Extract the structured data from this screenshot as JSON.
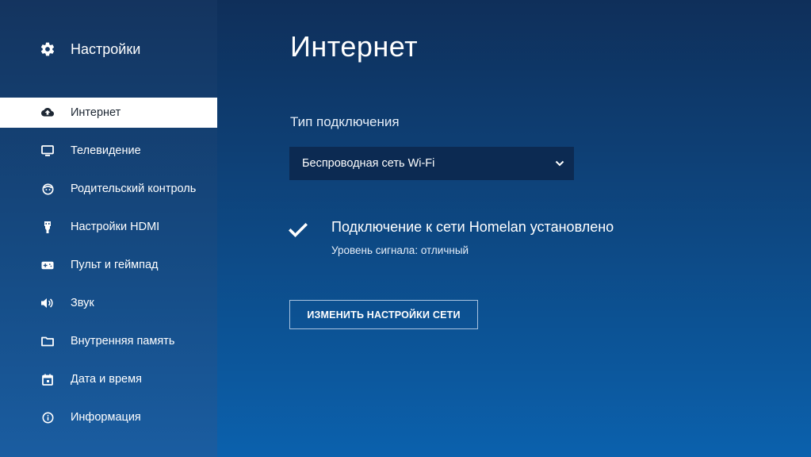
{
  "sidebar": {
    "header": {
      "title": "Настройки",
      "icon": "gear-icon"
    },
    "items": [
      {
        "label": "Интернет",
        "icon": "cloud-upload-icon",
        "active": true
      },
      {
        "label": "Телевидение",
        "icon": "tv-icon",
        "active": false
      },
      {
        "label": "Родительский контроль",
        "icon": "child-face-icon",
        "active": false
      },
      {
        "label": "Настройки HDMI",
        "icon": "hdmi-icon",
        "active": false
      },
      {
        "label": "Пульт и геймпад",
        "icon": "gamepad-icon",
        "active": false
      },
      {
        "label": "Звук",
        "icon": "volume-icon",
        "active": false
      },
      {
        "label": "Внутренняя память",
        "icon": "folder-icon",
        "active": false
      },
      {
        "label": "Дата и время",
        "icon": "calendar-icon",
        "active": false
      },
      {
        "label": "Информация",
        "icon": "info-icon",
        "active": false
      }
    ]
  },
  "main": {
    "title": "Интернет",
    "connection_type": {
      "label": "Тип подключения",
      "selected": "Беспроводная сеть Wi-Fi"
    },
    "status": {
      "title": "Подключение к сети Homelan установлено",
      "subtitle": "Уровень сигнала: отличный",
      "icon": "checkmark-icon"
    },
    "change_button": "ИЗМЕНИТЬ НАСТРОЙКИ СЕТИ"
  },
  "colors": {
    "active_item_bg": "#ffffff",
    "active_item_text": "#1d2733",
    "select_bg": "#0c2a52",
    "button_border": "#a9c3e0"
  }
}
